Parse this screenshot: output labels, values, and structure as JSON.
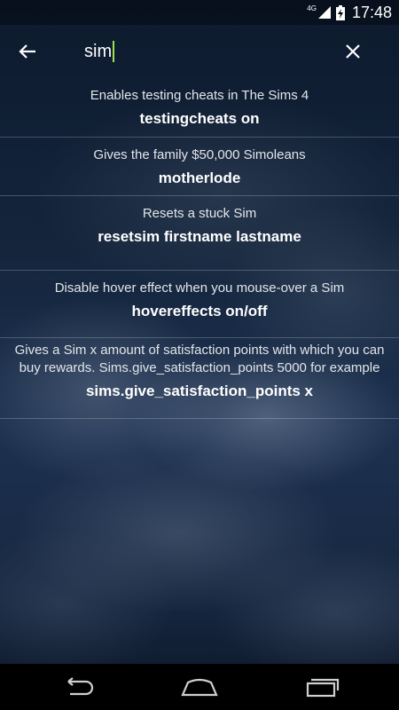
{
  "status_bar": {
    "network": "4G",
    "time": "17:48"
  },
  "search": {
    "value": "sim"
  },
  "results": [
    {
      "description": "Enables testing cheats in The Sims 4",
      "code": "testingcheats on"
    },
    {
      "description": "Gives the family $50,000 Simoleans",
      "code": "motherlode"
    },
    {
      "description": "Resets a stuck Sim",
      "code": "resetsim firstname lastname"
    },
    {
      "description": "Disable hover effect when you mouse-over a Sim",
      "code": "hovereffects on/off"
    },
    {
      "description": "Gives a Sim x amount of satisfaction points with which you can buy rewards. Sims.give_satisfaction_points 5000 for example",
      "code": "sims.give_satisfaction_points x"
    }
  ],
  "icons": {
    "back": "arrow-back-icon",
    "clear": "close-icon",
    "nav_back": "nav-back-icon",
    "nav_home": "nav-home-icon",
    "nav_recents": "nav-recents-icon"
  },
  "colors": {
    "cursor": "#9fe04a",
    "text": "#ffffff"
  }
}
